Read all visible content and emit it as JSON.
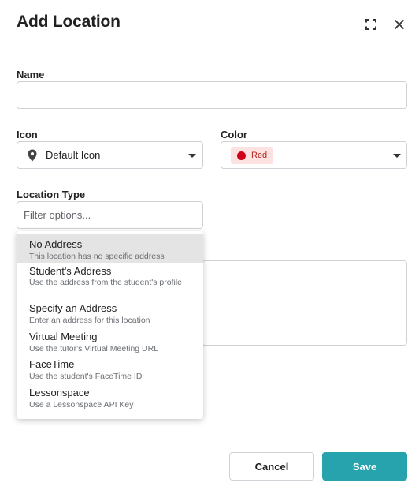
{
  "header": {
    "title": "Add Location"
  },
  "form": {
    "name_label": "Name",
    "name_value": "",
    "icon_label": "Icon",
    "icon_value": "Default Icon",
    "color_label": "Color",
    "color_value": "Red",
    "color_hex": "#d0021b",
    "location_type_label": "Location Type",
    "filter_placeholder": "Filter options..."
  },
  "dropdown": {
    "options": [
      {
        "title": "No Address",
        "desc": "This location has no specific address",
        "selected": true
      },
      {
        "title": "Student's Address",
        "desc": "Use the address from the student's profile"
      },
      {
        "title": "Specify an Address",
        "desc": "Enter an address for this location"
      },
      {
        "title": "Virtual Meeting",
        "desc": "Use the tutor's Virtual Meeting URL"
      },
      {
        "title": "FaceTime",
        "desc": "Use the student's FaceTime ID"
      },
      {
        "title": "Lessonspace",
        "desc": "Use a Lessonspace API Key"
      }
    ]
  },
  "footer": {
    "cancel_label": "Cancel",
    "save_label": "Save"
  },
  "colors": {
    "accent": "#26a3ad",
    "selected_option": "#e4e4e4"
  },
  "icons": {
    "expand": "expand-icon",
    "close": "close-icon",
    "location": "map-pin-icon"
  }
}
